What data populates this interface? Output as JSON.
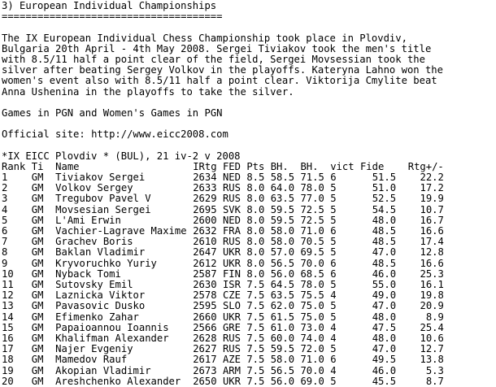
{
  "heading": {
    "title": "3) European Individual Championships",
    "underline": "====================================="
  },
  "intro": [
    "The IX European Individual Chess Championship took place in Plovdiv,",
    "Bulgaria 20th April - 4th May 2008. Sergei Tiviakov took the men's title",
    "with 8.5/11 half a point clear of the field, Sergei Movsessian took the",
    "silver after beating Sergey Volkov in the playoffs. Kateryna Lahno won the",
    "women's event also with 8.5/11 half a point clear. Viktorija Cmylite beat",
    "Anna Ushenina in the playoffs to take the silver."
  ],
  "games": {
    "prefix": "Games in ",
    "pgn_link": "PGN",
    "middle": " and ",
    "womens_link": "Women's Games in PGN"
  },
  "official": {
    "label": "Official site: ",
    "url": "http://www.eicc2008.com"
  },
  "event_line": "*IX EICC Plovdiv * (BUL), 21 iv-2 v 2008",
  "table": {
    "headers": [
      "Rank",
      "Ti",
      "Name",
      "IRtg",
      "FED",
      "Pts",
      "BH.",
      "BH.",
      "vict",
      "Fide",
      "Rtg+/-"
    ],
    "rows": [
      [
        "1",
        "GM",
        "Tiviakov Sergei",
        "2634",
        "NED",
        "8.5",
        "58.5",
        "71.5",
        "6",
        "51.5",
        "22.2"
      ],
      [
        "2",
        "GM",
        "Volkov Sergey",
        "2633",
        "RUS",
        "8.0",
        "64.0",
        "78.0",
        "5",
        "51.0",
        "17.2"
      ],
      [
        "3",
        "GM",
        "Tregubov Pavel V",
        "2629",
        "RUS",
        "8.0",
        "63.5",
        "77.0",
        "5",
        "52.5",
        "19.9"
      ],
      [
        "4",
        "GM",
        "Movsesian Sergei",
        "2695",
        "SVK",
        "8.0",
        "59.5",
        "72.5",
        "5",
        "54.5",
        "10.7"
      ],
      [
        "5",
        "GM",
        "L'Ami Erwin",
        "2600",
        "NED",
        "8.0",
        "59.5",
        "72.5",
        "5",
        "48.0",
        "16.7"
      ],
      [
        "6",
        "GM",
        "Vachier-Lagrave Maxime",
        "2632",
        "FRA",
        "8.0",
        "58.0",
        "71.0",
        "6",
        "48.5",
        "16.6"
      ],
      [
        "7",
        "GM",
        "Grachev Boris",
        "2610",
        "RUS",
        "8.0",
        "58.0",
        "70.5",
        "5",
        "48.5",
        "17.4"
      ],
      [
        "8",
        "GM",
        "Baklan Vladimir",
        "2647",
        "UKR",
        "8.0",
        "57.0",
        "69.5",
        "5",
        "47.0",
        "12.8"
      ],
      [
        "9",
        "GM",
        "Kryvoruchko Yuriy",
        "2612",
        "UKR",
        "8.0",
        "56.5",
        "70.0",
        "6",
        "48.5",
        "16.6"
      ],
      [
        "10",
        "GM",
        "Nyback Tomi",
        "2587",
        "FIN",
        "8.0",
        "56.0",
        "68.5",
        "6",
        "46.0",
        "25.3"
      ],
      [
        "11",
        "GM",
        "Sutovsky Emil",
        "2630",
        "ISR",
        "7.5",
        "64.5",
        "78.0",
        "5",
        "55.0",
        "16.1"
      ],
      [
        "12",
        "GM",
        "Laznicka Viktor",
        "2578",
        "CZE",
        "7.5",
        "63.5",
        "75.5",
        "4",
        "49.0",
        "19.8"
      ],
      [
        "13",
        "GM",
        "Pavasovic Dusko",
        "2595",
        "SLO",
        "7.5",
        "62.0",
        "75.0",
        "5",
        "47.0",
        "20.9"
      ],
      [
        "14",
        "GM",
        "Efimenko Zahar",
        "2660",
        "UKR",
        "7.5",
        "61.5",
        "75.0",
        "5",
        "48.0",
        "8.9"
      ],
      [
        "15",
        "GM",
        "Papaioannou Ioannis",
        "2566",
        "GRE",
        "7.5",
        "61.0",
        "73.0",
        "4",
        "47.5",
        "25.4"
      ],
      [
        "16",
        "GM",
        "Khalifman Alexander",
        "2628",
        "RUS",
        "7.5",
        "60.0",
        "74.0",
        "4",
        "48.0",
        "10.6"
      ],
      [
        "17",
        "GM",
        "Najer Evgeniy",
        "2627",
        "RUS",
        "7.5",
        "59.5",
        "72.0",
        "5",
        "47.0",
        "12.7"
      ],
      [
        "18",
        "GM",
        "Mamedov Rauf",
        "2617",
        "AZE",
        "7.5",
        "58.0",
        "71.0",
        "6",
        "49.5",
        "13.8"
      ],
      [
        "19",
        "GM",
        "Akopian Vladimir",
        "2673",
        "ARM",
        "7.5",
        "56.5",
        "70.0",
        "4",
        "46.0",
        "5.3"
      ],
      [
        "20",
        "GM",
        "Areshchenko Alexander",
        "2650",
        "UKR",
        "7.5",
        "56.0",
        "69.0",
        "5",
        "45.5",
        "8.7"
      ]
    ]
  }
}
